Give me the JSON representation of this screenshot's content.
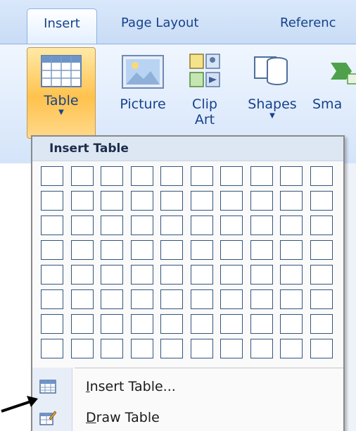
{
  "ribbon_tabs": [
    {
      "label": "Insert",
      "active": true
    },
    {
      "label": "Page Layout",
      "active": false
    },
    {
      "label": "Referenc",
      "active": false
    }
  ],
  "ribbon_buttons": {
    "table": {
      "label": "Table",
      "icon": "table-grid-icon"
    },
    "picture": {
      "label": "Picture",
      "icon": "picture-icon"
    },
    "clip_art": {
      "label_line1": "Clip",
      "label_line2": "Art",
      "icon": "clip-art-icon"
    },
    "shapes": {
      "label": "Shapes",
      "icon": "shapes-icon"
    },
    "smartart": {
      "label": "Sma",
      "icon": "smartart-icon"
    }
  },
  "insert_table_menu": {
    "title": "Insert Table",
    "grid": {
      "columns": 10,
      "rows": 8
    },
    "items": [
      {
        "accel": "I",
        "rest": "nsert Table...",
        "icon": "insert-table-icon"
      },
      {
        "accel": "D",
        "rest": "raw Table",
        "icon": "draw-table-icon"
      }
    ]
  },
  "colors": {
    "tab_text": "#15428b",
    "ribbon_bg": "#d4e4f9",
    "table_button_highlight": "#ffc24d",
    "grid_border": "#34557d",
    "menu_header_bg": "#dde7f4"
  }
}
